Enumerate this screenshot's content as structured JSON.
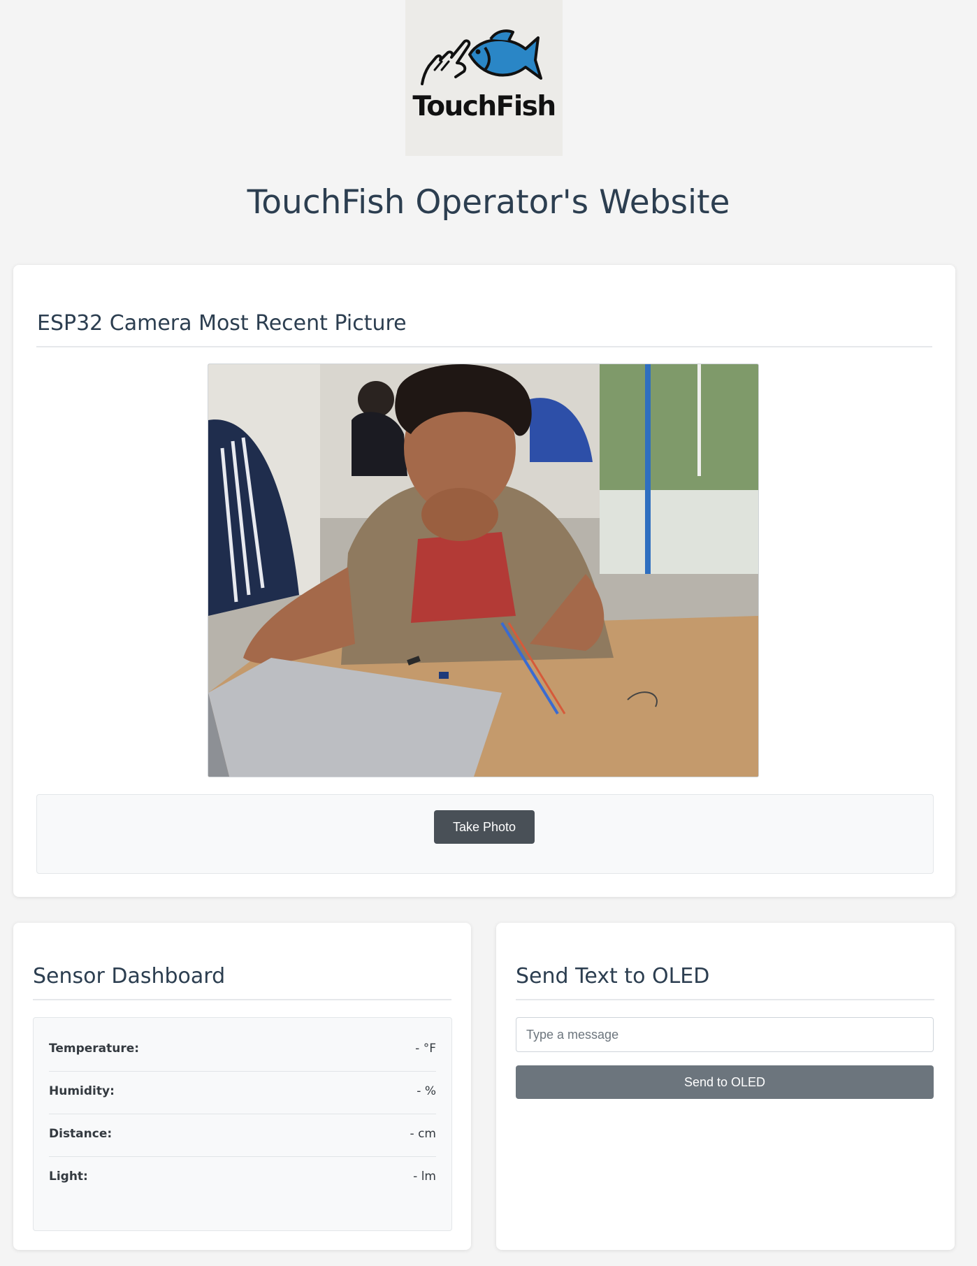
{
  "logo": {
    "text": "TouchFish",
    "icon": "hand-touching-fish-logo",
    "fish_color": "#2a86c6"
  },
  "page": {
    "title": "TouchFish Operator's Website"
  },
  "camera": {
    "title": "ESP32 Camera Most Recent Picture",
    "photo_subject": "camera-photo",
    "take_photo_label": "Take Photo"
  },
  "sensors": {
    "title": "Sensor Dashboard",
    "rows": [
      {
        "label": "Temperature:",
        "value": "- °F"
      },
      {
        "label": "Humidity:",
        "value": "- %"
      },
      {
        "label": "Distance:",
        "value": "- cm"
      },
      {
        "label": "Light:",
        "value": "- lm"
      }
    ]
  },
  "oled": {
    "title": "Send Text to OLED",
    "input_placeholder": "Type a message",
    "input_value": "",
    "send_label": "Send to OLED"
  },
  "colors": {
    "page_background": "#f4f4f4",
    "heading": "#2c3e50",
    "button_dark": "#495057",
    "button_gray": "#6c757d"
  }
}
